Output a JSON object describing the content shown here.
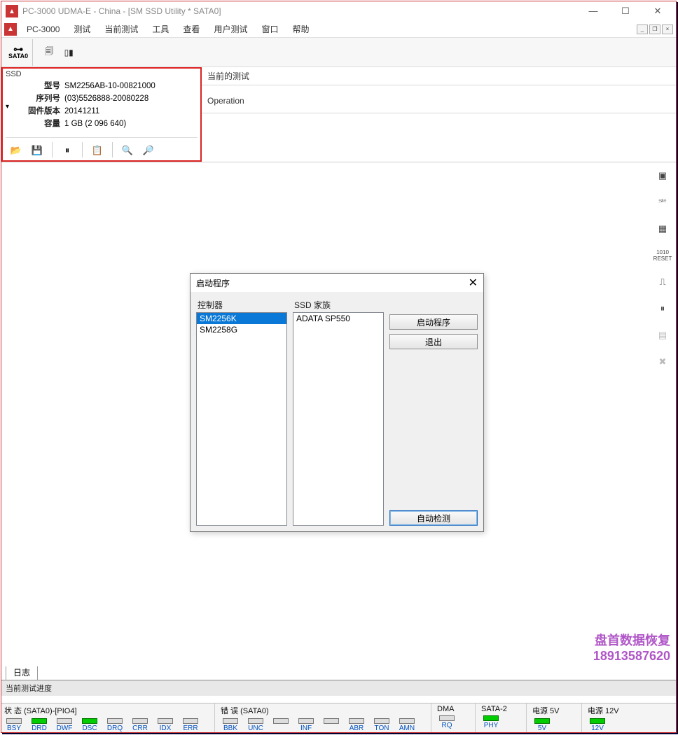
{
  "title": "PC-3000 UDMA-E - China - [SM SSD Utility * SATA0]",
  "app_label": "PC-3000",
  "menu": [
    "测试",
    "当前测试",
    "工具",
    "查看",
    "用户测试",
    "窗口",
    "帮助"
  ],
  "sata_label": "SATA0",
  "ssd": {
    "header": "SSD",
    "labels": {
      "model": "型号",
      "serial": "序列号",
      "fw": "固件版本",
      "capacity": "容量"
    },
    "model": "SM2256AB-10-00821000",
    "serial": "(03)5526888-20080228",
    "firmware": "20141211",
    "capacity": "1 GB (2 096 640)"
  },
  "right_rows": [
    "当前的测试",
    "Operation"
  ],
  "dialog": {
    "title": "启动程序",
    "controller_label": "控制器",
    "family_label": "SSD 家族",
    "controllers": [
      "SM2256K",
      "SM2258G"
    ],
    "families": [
      "ADATA SP550"
    ],
    "btn_start": "启动程序",
    "btn_quit": "退出",
    "btn_detect": "自动检测"
  },
  "watermark": {
    "line1": "盘首数据恢复",
    "line2": "18913587620"
  },
  "logs_tab": "日志",
  "progress_label": "当前测试进度",
  "status": {
    "hdr_status": "状 态 (SATA0)-[PIO4]",
    "hdr_errors": "错 误 (SATA0)",
    "hdr_dma": "DMA",
    "hdr_sata": "SATA-2",
    "hdr_p5": "电源 5V",
    "hdr_p12": "电源 12V",
    "leds_status": [
      {
        "l": "BSY",
        "on": false
      },
      {
        "l": "DRD",
        "on": true
      },
      {
        "l": "DWF",
        "on": false
      },
      {
        "l": "DSC",
        "on": true
      },
      {
        "l": "DRQ",
        "on": false
      },
      {
        "l": "CRR",
        "on": false
      },
      {
        "l": "IDX",
        "on": false
      },
      {
        "l": "ERR",
        "on": false
      }
    ],
    "leds_errors": [
      {
        "l": "BBK",
        "on": false
      },
      {
        "l": "UNC",
        "on": false
      },
      {
        "l": "",
        "on": false
      },
      {
        "l": "INF",
        "on": false
      },
      {
        "l": "",
        "on": false
      },
      {
        "l": "ABR",
        "on": false
      },
      {
        "l": "TON",
        "on": false
      },
      {
        "l": "AMN",
        "on": false
      }
    ],
    "led_dma": {
      "l": "RQ",
      "on": false
    },
    "led_sata": {
      "l": "PHY",
      "on": true
    },
    "led_5v": {
      "l": "5V",
      "on": true
    },
    "led_12v": {
      "l": "12V",
      "on": true
    }
  }
}
